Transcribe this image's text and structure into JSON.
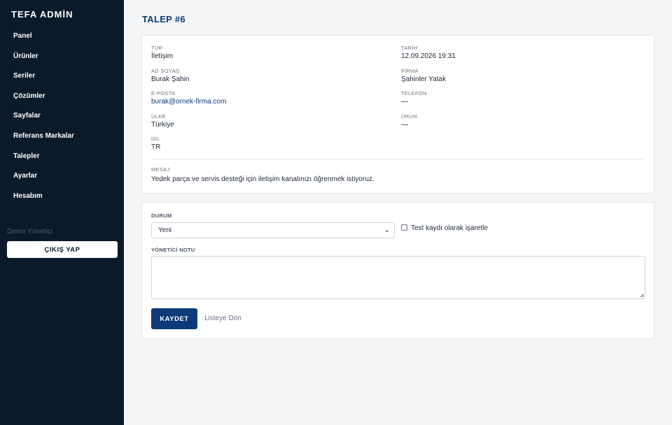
{
  "sidebar": {
    "brand": "TEFA ADMİN",
    "items": [
      {
        "label": "Panel"
      },
      {
        "label": "Ürünler"
      },
      {
        "label": "Seriler"
      },
      {
        "label": "Çözümler"
      },
      {
        "label": "Sayfalar"
      },
      {
        "label": "Referans Markalar"
      },
      {
        "label": "Talepler"
      },
      {
        "label": "Ayarlar"
      },
      {
        "label": "Hesabım"
      }
    ],
    "user": "Demo Yönetici",
    "logout_label": "ÇIKIŞ YAP"
  },
  "page": {
    "title": "TALEP #6"
  },
  "request": {
    "type": {
      "label": "TÜR",
      "value": "İletişim"
    },
    "date": {
      "label": "TARİH",
      "value": "12.09.2026 19:31"
    },
    "name": {
      "label": "AD SOYAD",
      "value": "Burak Şahin"
    },
    "company": {
      "label": "FİRMA",
      "value": "Şahinler Yatak"
    },
    "email": {
      "label": "E-POSTA",
      "value": "burak@ornek-firma.com"
    },
    "phone": {
      "label": "TELEFON",
      "value": "—"
    },
    "country": {
      "label": "ÜLKE",
      "value": "Türkiye"
    },
    "product": {
      "label": "ÜRÜN",
      "value": "—"
    },
    "language": {
      "label": "DİL",
      "value": "TR"
    },
    "message": {
      "label": "MESAJ",
      "value": "Yedek parça ve servis desteği için iletişim kanalınızı öğrenmek istiyoruz."
    }
  },
  "form": {
    "status_label": "DURUM",
    "status_value": "Yeni",
    "test_checkbox_label": "Test kaydı olarak işaretle",
    "test_checked": false,
    "note_label": "YÖNETİCİ NOTU",
    "note_value": "",
    "save_label": "KAYDET",
    "back_label": "Listeye Dön"
  },
  "colors": {
    "sidebar_bg": "#0b1a2b",
    "accent": "#0d3a78",
    "page_bg": "#f4f5f7"
  },
  "icons": {
    "select_chevron": "chevron-down-icon",
    "resize_grip": "resize-grip-icon"
  }
}
